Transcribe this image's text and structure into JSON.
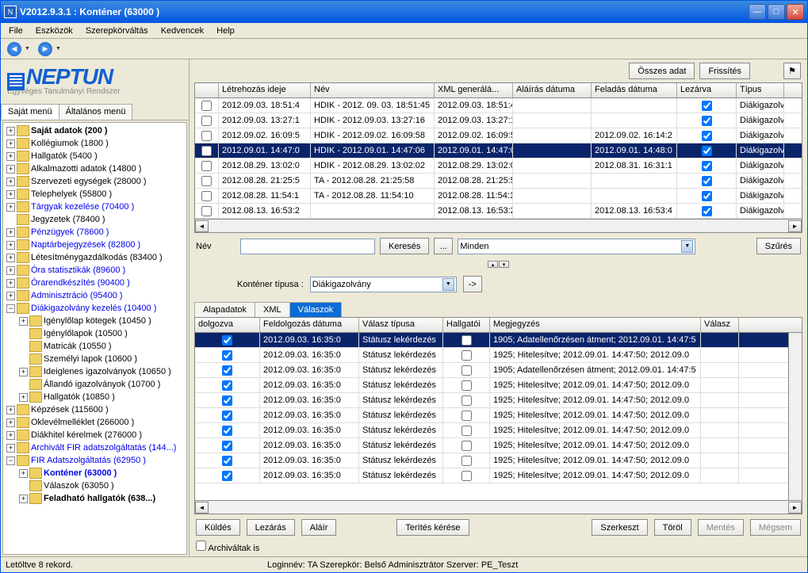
{
  "window": {
    "title": "V2012.9.3.1 : Konténer (63000  )"
  },
  "menu": {
    "file": "File",
    "tools": "Eszközök",
    "roles": "Szerepkörváltás",
    "fav": "Kedvencek",
    "help": "Help"
  },
  "logo": {
    "main": "NEPTUN",
    "sub": "Egységes Tanulmányi Rendszer"
  },
  "tabs_left": {
    "own": "Saját menü",
    "gen": "Általános menü"
  },
  "tree": [
    {
      "l": 1,
      "exp": "+",
      "label": "Saját adatok (200  )",
      "bold": true
    },
    {
      "l": 1,
      "exp": "+",
      "label": "Kollégiumok (1800  )"
    },
    {
      "l": 1,
      "exp": "+",
      "label": "Hallgatók (5400  )"
    },
    {
      "l": 1,
      "exp": "+",
      "label": "Alkalmazotti adatok (14800  )"
    },
    {
      "l": 1,
      "exp": "+",
      "label": "Szervezeti egységek (28000  )"
    },
    {
      "l": 1,
      "exp": "+",
      "label": "Telephelyek (55800  )"
    },
    {
      "l": 1,
      "exp": "+",
      "label": "Tárgyak kezelése (70400  )",
      "blue": true
    },
    {
      "l": 1,
      "exp": "",
      "label": "Jegyzetek (78400  )"
    },
    {
      "l": 1,
      "exp": "+",
      "label": "Pénzügyek (78600  )",
      "blue": true
    },
    {
      "l": 1,
      "exp": "+",
      "label": "Naptárbejegyzések (82800  )",
      "blue": true
    },
    {
      "l": 1,
      "exp": "+",
      "label": "Létesítménygazdálkodás (83400  )"
    },
    {
      "l": 1,
      "exp": "+",
      "label": "Óra statisztikák (89600  )",
      "blue": true
    },
    {
      "l": 1,
      "exp": "+",
      "label": "Órarendkészítés (90400  )",
      "blue": true
    },
    {
      "l": 1,
      "exp": "+",
      "label": "Adminisztráció (95400  )",
      "blue": true
    },
    {
      "l": 1,
      "exp": "-",
      "label": "Diákigazolvány kezelés (10400  )",
      "blue": true
    },
    {
      "l": 2,
      "exp": "+",
      "label": "Igénylőlap kötegek (10450  )"
    },
    {
      "l": 2,
      "exp": "",
      "label": "Igénylőlapok (10500  )"
    },
    {
      "l": 2,
      "exp": "",
      "label": "Matricák (10550  )"
    },
    {
      "l": 2,
      "exp": "",
      "label": "Személyi lapok (10600  )"
    },
    {
      "l": 2,
      "exp": "+",
      "label": "Ideiglenes igazolványok (10650  )"
    },
    {
      "l": 2,
      "exp": "",
      "label": "Állandó igazolványok (10700  )"
    },
    {
      "l": 2,
      "exp": "+",
      "label": "Hallgatók (10850  )"
    },
    {
      "l": 1,
      "exp": "+",
      "label": "Képzések (115600  )"
    },
    {
      "l": 1,
      "exp": "+",
      "label": "Oklevélmelléklet (266000  )"
    },
    {
      "l": 1,
      "exp": "+",
      "label": "Diákhitel kérelmek (276000  )"
    },
    {
      "l": 1,
      "exp": "+",
      "label": "Archivált FIR adatszolgáltatás (144...)",
      "blue": true
    },
    {
      "l": 1,
      "exp": "-",
      "label": "FIR Adatszolgáltatás (62950  )",
      "blue": true
    },
    {
      "l": 2,
      "exp": "+",
      "label": "Konténer (63000  )",
      "blue": true,
      "bold": true
    },
    {
      "l": 2,
      "exp": "",
      "label": "Válaszok (63050  )"
    },
    {
      "l": 2,
      "exp": "+",
      "label": "Feladható hallgatók (638...)",
      "bold": true
    }
  ],
  "top_buttons": {
    "all_data": "Összes adat",
    "refresh": "Frissítés"
  },
  "grid1": {
    "cols": [
      "",
      "Létrehozás ideje",
      "Név",
      "XML generálá...",
      "Aláírás dátuma",
      "Feladás dátuma",
      "Lezárva",
      "Típus"
    ],
    "rows": [
      {
        "sel": false,
        "c1": "2012.09.03. 18:51:4",
        "c2": "HDIK - 2012. 09. 03. 18:51:45",
        "c3": "2012.09.03. 18:51:4",
        "c4": "",
        "c5": "",
        "lez": true,
        "c7": "Diákigazolv"
      },
      {
        "sel": false,
        "c1": "2012.09.03. 13:27:1",
        "c2": "HDIK - 2012.09.03. 13:27:16",
        "c3": "2012.09.03. 13:27:1",
        "c4": "",
        "c5": "",
        "lez": true,
        "c7": "Diákigazolv"
      },
      {
        "sel": false,
        "c1": "2012.09.02. 16:09:5",
        "c2": "HDIK - 2012.09.02. 16:09:58",
        "c3": "2012.09.02. 16:09:5",
        "c4": "",
        "c5": "2012.09.02. 16:14:2",
        "lez": true,
        "c7": "Diákigazolv"
      },
      {
        "sel": true,
        "c1": "2012.09.01. 14:47:0",
        "c2": "HDIK - 2012.09.01. 14:47:06",
        "c3": "2012.09.01. 14:47:0",
        "c4": "",
        "c5": "2012.09.01. 14:48:0",
        "lez": true,
        "c7": "Diákigazolv"
      },
      {
        "sel": false,
        "c1": "2012.08.29. 13:02:0",
        "c2": "HDIK - 2012.08.29. 13:02:02",
        "c3": "2012.08.29. 13:02:0",
        "c4": "",
        "c5": "2012.08.31. 16:31:1",
        "lez": true,
        "c7": "Diákigazolv"
      },
      {
        "sel": false,
        "c1": "2012.08.28. 21:25:5",
        "c2": "TA - 2012.08.28. 21:25:58",
        "c3": "2012.08.28. 21:25:5",
        "c4": "",
        "c5": "",
        "lez": true,
        "c7": "Diákigazolv"
      },
      {
        "sel": false,
        "c1": "2012.08.28. 11:54:1",
        "c2": "TA - 2012.08.28. 11:54:10",
        "c3": "2012.08.28. 11:54:1",
        "c4": "",
        "c5": "",
        "lez": true,
        "c7": "Diákigazolv"
      },
      {
        "sel": false,
        "c1": "2012.08.13. 16:53:2",
        "c2": "",
        "c3": "2012.08.13. 16:53:2",
        "c4": "",
        "c5": "2012.08.13. 16:53:4",
        "lez": true,
        "c7": "Diákigazolv"
      }
    ]
  },
  "search": {
    "name_label": "Név",
    "btn": "Keresés",
    "dots": "...",
    "filter_combo": "Minden",
    "filter_btn": "Szűrés"
  },
  "container": {
    "label": "Konténer típusa :",
    "value": "Diákigazolvány",
    "go": "->"
  },
  "tabs_mid": {
    "a": "Alapadatok",
    "b": "XML",
    "c": "Válaszok"
  },
  "grid2": {
    "cols": [
      "dolgozva",
      "Feldolgozás dátuma",
      "Válasz típusa",
      "Hallgatói",
      "Megjegyzés",
      "Válasz"
    ],
    "rows": [
      {
        "sel": true,
        "c1": "2012.09.03. 16:35:0",
        "c2": "Státusz lekérdezés",
        "h": false,
        "c4": "1905;  Adatellenőrzésen átment;  2012.09.01. 14:47:5"
      },
      {
        "sel": false,
        "c1": "2012.09.03. 16:35:0",
        "c2": "Státusz lekérdezés",
        "h": false,
        "c4": "1925;  Hitelesítve;  2012.09.01. 14:47:50;  2012.09.0"
      },
      {
        "sel": false,
        "c1": "2012.09.03. 16:35:0",
        "c2": "Státusz lekérdezés",
        "h": false,
        "c4": "1905;  Adatellenőrzésen átment;  2012.09.01. 14:47:5"
      },
      {
        "sel": false,
        "c1": "2012.09.03. 16:35:0",
        "c2": "Státusz lekérdezés",
        "h": false,
        "c4": "1925;  Hitelesítve;  2012.09.01. 14:47:50;  2012.09.0"
      },
      {
        "sel": false,
        "c1": "2012.09.03. 16:35:0",
        "c2": "Státusz lekérdezés",
        "h": false,
        "c4": "1925;  Hitelesítve;  2012.09.01. 14:47:50;  2012.09.0"
      },
      {
        "sel": false,
        "c1": "2012.09.03. 16:35:0",
        "c2": "Státusz lekérdezés",
        "h": false,
        "c4": "1925;  Hitelesítve;  2012.09.01. 14:47:50;  2012.09.0"
      },
      {
        "sel": false,
        "c1": "2012.09.03. 16:35:0",
        "c2": "Státusz lekérdezés",
        "h": false,
        "c4": "1925;  Hitelesítve;  2012.09.01. 14:47:50;  2012.09.0"
      },
      {
        "sel": false,
        "c1": "2012.09.03. 16:35:0",
        "c2": "Státusz lekérdezés",
        "h": false,
        "c4": "1925;  Hitelesítve;  2012.09.01. 14:47:50;  2012.09.0"
      },
      {
        "sel": false,
        "c1": "2012.09.03. 16:35:0",
        "c2": "Státusz lekérdezés",
        "h": false,
        "c4": "1925;  Hitelesítve;  2012.09.01. 14:47:50;  2012.09.0"
      },
      {
        "sel": false,
        "c1": "2012.09.03. 16:35:0",
        "c2": "Státusz lekérdezés",
        "h": false,
        "c4": "1925;  Hitelesítve;  2012.09.01. 14:47:50;  2012.09.0"
      }
    ]
  },
  "bottom": {
    "send": "Küldés",
    "close": "Lezárás",
    "sign": "Aláír",
    "terit": "Terítés kérése",
    "edit": "Szerkeszt",
    "del": "Töröl",
    "save": "Mentés",
    "cancel": "Mégsem",
    "arch": "Archiváltak is"
  },
  "status": {
    "left": "Letöltve 8 rekord.",
    "right": "Loginnév: TA   Szerepkör: Belső Adminisztrátor   Szerver: PE_Teszt"
  }
}
